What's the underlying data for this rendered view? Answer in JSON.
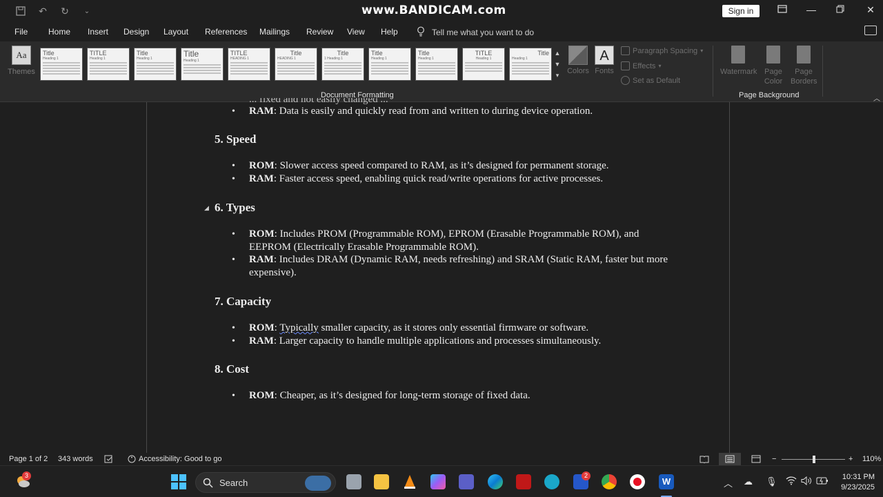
{
  "titlebar": {
    "watermark": "www.BANDICAM.com",
    "sign_in": "Sign in"
  },
  "menu": {
    "items": [
      "File",
      "Home",
      "Insert",
      "Design",
      "Layout",
      "References",
      "Mailings",
      "Review",
      "View",
      "Help"
    ],
    "active": "Design",
    "tell_me": "Tell me what you want to do"
  },
  "ribbon": {
    "themes_label": "Themes",
    "theme_gallery": [
      {
        "title": "Title",
        "heading": "Heading 1"
      },
      {
        "title": "TITLE",
        "heading": "Heading 1"
      },
      {
        "title": "Title",
        "heading": "Heading 1"
      },
      {
        "title": "Title",
        "heading": "Heading 1"
      },
      {
        "title": "TITLE",
        "heading": "HEADING 1"
      },
      {
        "title": "Title",
        "heading": "HEADING 1"
      },
      {
        "title": "Title",
        "heading": "1  Heading 1"
      },
      {
        "title": "Title",
        "heading": "Heading 1"
      },
      {
        "title": "Title",
        "heading": "Heading 1"
      },
      {
        "title": "TITLE",
        "heading": "Heading 1"
      },
      {
        "title": "Title",
        "heading": "Heading 1"
      }
    ],
    "document_formatting_label": "Document Formatting",
    "colors_label": "Colors",
    "fonts_label": "Fonts",
    "paragraph_spacing": "Paragraph Spacing",
    "effects": "Effects",
    "set_as_default": "Set as Default",
    "watermark_label": "Watermark",
    "page_color_label": "Page Color",
    "page_borders_label": "Page Borders",
    "page_background_label": "Page Background"
  },
  "document": {
    "partial_line": "... fixed and not easily changed ...",
    "ram_prev": {
      "term": "RAM",
      "text": ": Data is easily and quickly read from and written to during device operation."
    },
    "sections": [
      {
        "heading": "5. Speed",
        "bullets": [
          {
            "term": "ROM",
            "text": ": Slower access speed compared to RAM, as it’s designed for permanent storage."
          },
          {
            "term": "RAM",
            "text": ": Faster access speed, enabling quick read/write operations for active processes."
          }
        ]
      },
      {
        "heading": "6. Types",
        "bullets": [
          {
            "term": "ROM",
            "text": ": Includes PROM (Programmable ROM), EPROM (Erasable Programmable ROM), and EEPROM (Electrically Erasable Programmable ROM)."
          },
          {
            "term": "RAM",
            "text": ": Includes DRAM (Dynamic RAM, needs refreshing) and SRAM (Static RAM, faster but more expensive)."
          }
        ]
      },
      {
        "heading": "7. Capacity",
        "bullets": [
          {
            "term": "ROM",
            "text_pre": ": ",
            "text_flagged": "Typically",
            "text": " smaller capacity, as it stores only essential firmware or software."
          },
          {
            "term": "RAM",
            "text": ": Larger capacity to handle multiple applications and processes simultaneously."
          }
        ]
      },
      {
        "heading": "8. Cost",
        "bullets": [
          {
            "term": "ROM",
            "text": ": Cheaper, as it’s designed for long-term storage of fixed data."
          }
        ]
      }
    ]
  },
  "statusbar": {
    "page": "Page 1 of 2",
    "words": "343 words",
    "accessibility": "Accessibility: Good to go",
    "zoom": "110%",
    "zoom_level_percent": 110
  },
  "taskbar": {
    "search_label": "Search",
    "weather_badge": "3",
    "app_badge": "2",
    "time": "10:31 PM",
    "date": "9/23/2025"
  },
  "colors": {
    "accent_blue": "#78a9ff",
    "record_red": "#e81123",
    "word_blue": "#185abd"
  }
}
